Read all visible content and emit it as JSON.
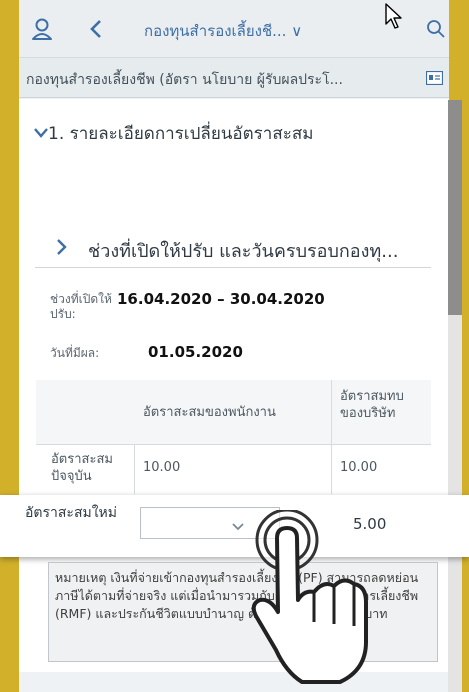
{
  "header": {
    "title": "กองทุนสำรองเลี้ยงชี... ∨",
    "icons": [
      "person-icon",
      "back-chevron-icon",
      "search-icon"
    ]
  },
  "subheader": {
    "text": "กองทุนสำรองเลี้ยงชีพ (อัตรา นโยบาย ผู้รับผลประโ...",
    "icon": "id-card-icon"
  },
  "section": {
    "title": "1. รายละเอียดการเปลี่ยนอัตราสะสม"
  },
  "subsection": {
    "title": "ช่วงที่เปิดให้ปรับ และวันครบรอบกองทุ..."
  },
  "fields": {
    "window_label": "ช่วงที่เปิดให้ปรับ:",
    "window_value": "16.04.2020 – 30.04.2020",
    "effective_label": "วันที่มีผล:",
    "effective_value": "01.05.2020"
  },
  "table": {
    "col_employee": "อัตราสะสมของพนักงาน",
    "col_company": "อัตราสมทบของบริษัท",
    "row_current_label": "อัตราสะสมปัจจุบัน",
    "row_current_employee": "10.00",
    "row_current_company": "10.00",
    "row_new_label": "อัตราสะสมใหม่",
    "row_new_company": "5.00"
  },
  "note": {
    "text": "หมายเหตุ เงินที่จ่ายเข้ากองทุนสำรองเลี้ยงชีพ (PF) สามารถลดหย่อนภาษีได้ตามที่จ่ายจริง แต่เมื่อนำมารวมกับกองทุนรวมเพื่อการเลี้ยงชีพ (RMF) และประกันชีวิตแบบบำนาญ ต้องไม่เกิน 500,000 บาท"
  },
  "colors": {
    "background": "#d2b02a",
    "accent": "#3d6fa6",
    "header_bg": "#eaeef1"
  }
}
